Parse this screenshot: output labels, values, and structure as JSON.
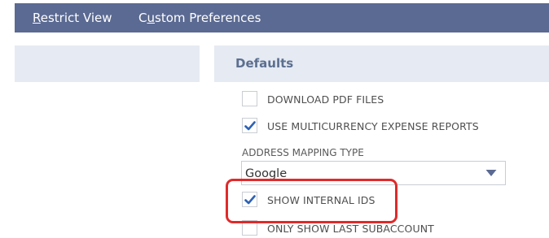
{
  "tabs": [
    {
      "label_underlined": "R",
      "label_rest": "estrict View"
    },
    {
      "label_prefix": "C",
      "label_underlined": "u",
      "label_rest": "stom Preferences"
    }
  ],
  "section": {
    "title": "Defaults"
  },
  "options": {
    "download_pdf": {
      "label": "DOWNLOAD PDF FILES",
      "checked": false
    },
    "multicurrency": {
      "label": "USE MULTICURRENCY EXPENSE REPORTS",
      "checked": true
    },
    "internal_ids": {
      "label": "SHOW INTERNAL IDS",
      "checked": true
    },
    "last_subaccount": {
      "label": "ONLY SHOW LAST SUBACCOUNT",
      "checked": false
    }
  },
  "address_mapping": {
    "label": "ADDRESS MAPPING TYPE",
    "value": "Google"
  },
  "colors": {
    "tabbar": "#5b6a92",
    "header_panel": "#e5eaf3",
    "checkmark": "#2d62b6",
    "highlight": "#e02a2a"
  },
  "icons": {
    "checkbox_check": "checkmark-icon",
    "dropdown": "caret-down-icon"
  }
}
